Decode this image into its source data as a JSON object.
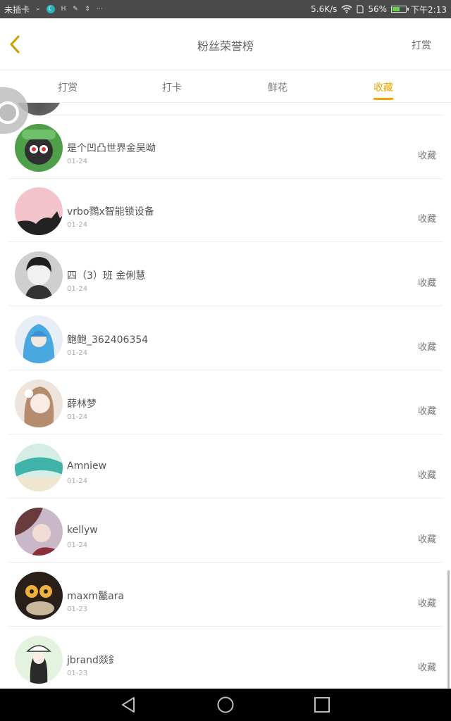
{
  "status_bar": {
    "carrier": "未插卡",
    "speed": "5.6K/s",
    "battery": "56%",
    "battery_level": 0.56,
    "time": "下午2:13",
    "icons": [
      "search-icon",
      "moon-icon",
      "h-icon",
      "settings-icon",
      "nav-icon",
      "more-icon",
      "wifi-icon",
      "sim-icon",
      "battery-icon"
    ]
  },
  "header": {
    "title": "粉丝荣誉榜",
    "action": "打赏",
    "back_icon": "chevron-left-icon"
  },
  "tabs": [
    {
      "label": "打赏",
      "active": false
    },
    {
      "label": "打卡",
      "active": false
    },
    {
      "label": "鲜花",
      "active": false
    },
    {
      "label": "收藏",
      "active": true
    }
  ],
  "list": [
    {
      "name": "是个凹凸世界金吴呦",
      "date": "01-24",
      "action": "收藏"
    },
    {
      "name": "vrbo鷚x智能锁设备",
      "date": "01-24",
      "action": "收藏"
    },
    {
      "name": "四（3）班 金俐慧",
      "date": "01-24",
      "action": "收藏"
    },
    {
      "name": "鲍鲍_362406354",
      "date": "01-24",
      "action": "收藏"
    },
    {
      "name": "薛林梦",
      "date": "01-24",
      "action": "收藏"
    },
    {
      "name": "Amniew",
      "date": "01-24",
      "action": "收藏"
    },
    {
      "name": "kellyw",
      "date": "01-24",
      "action": "收藏"
    },
    {
      "name": "maxm鬣ara",
      "date": "01-23",
      "action": "收藏"
    },
    {
      "name": "jbrand燚釒",
      "date": "01-23",
      "action": "收藏"
    }
  ],
  "colors": {
    "accent": "#f0a500",
    "status_bar": "#4a4a4a",
    "nav_bar": "#000000"
  }
}
